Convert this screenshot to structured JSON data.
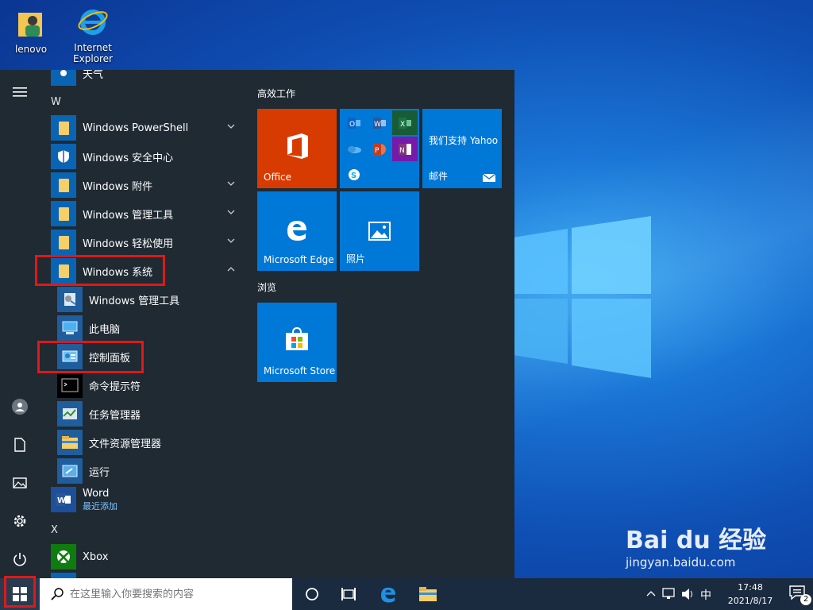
{
  "desktop": {
    "icons": [
      {
        "label": "lenovo",
        "icon": "user-folder-icon"
      },
      {
        "label": "Internet Explorer",
        "icon": "ie-icon"
      }
    ]
  },
  "start_menu": {
    "partial_top_label": "天气",
    "sections": {
      "w": "W",
      "x": "X"
    },
    "apps": [
      {
        "label": "Windows PowerShell",
        "icon": "folder-icon",
        "expandable": true
      },
      {
        "label": "Windows 安全中心",
        "icon": "shield-icon",
        "expandable": false
      },
      {
        "label": "Windows 附件",
        "icon": "folder-icon",
        "expandable": true
      },
      {
        "label": "Windows 管理工具",
        "icon": "folder-icon",
        "expandable": true
      },
      {
        "label": "Windows 轻松使用",
        "icon": "folder-icon",
        "expandable": true
      },
      {
        "label": "Windows 系统",
        "icon": "folder-icon",
        "expandable": true,
        "expanded": true
      },
      {
        "label": "Windows 管理工具",
        "icon": "admin-tools-icon",
        "sub": true
      },
      {
        "label": "此电脑",
        "icon": "computer-icon",
        "sub": true
      },
      {
        "label": "控制面板",
        "icon": "control-panel-icon",
        "sub": true
      },
      {
        "label": "命令提示符",
        "icon": "cmd-icon",
        "sub": true
      },
      {
        "label": "任务管理器",
        "icon": "task-manager-icon",
        "sub": true
      },
      {
        "label": "文件资源管理器",
        "icon": "explorer-icon",
        "sub": true
      },
      {
        "label": "运行",
        "icon": "run-icon",
        "sub": true
      },
      {
        "label": "Word",
        "sublabel": "最近添加",
        "icon": "word-icon"
      },
      {
        "label": "Xbox",
        "icon": "xbox-icon"
      }
    ],
    "tile_groups": [
      {
        "title": "高效工作"
      },
      {
        "title": "浏览"
      }
    ],
    "tiles": {
      "office": "Office",
      "yahoo_text": "我们支持 Yahoo",
      "mail": "邮件",
      "edge": "Microsoft Edge",
      "photos": "照片",
      "store": "Microsoft Store"
    },
    "mini_tiles": [
      "outlook-icon",
      "word-icon",
      "excel-icon",
      "onedrive-icon",
      "powerpoint-icon",
      "onenote-icon",
      "skype-icon"
    ]
  },
  "taskbar": {
    "search_placeholder": "在这里输入你要搜索的内容",
    "ime": "中",
    "time": "17:48",
    "date": "2021/8/17",
    "notification_count": "2"
  },
  "watermark": {
    "brand": "Bai du 经验",
    "url": "jingyan.baidu.com"
  },
  "colors": {
    "start_bg": "#1f2a33",
    "tile_blue": "#0078d7",
    "office_orange": "#d83b01",
    "highlight_red": "#e01818",
    "taskbar": "#1a2a3f"
  }
}
